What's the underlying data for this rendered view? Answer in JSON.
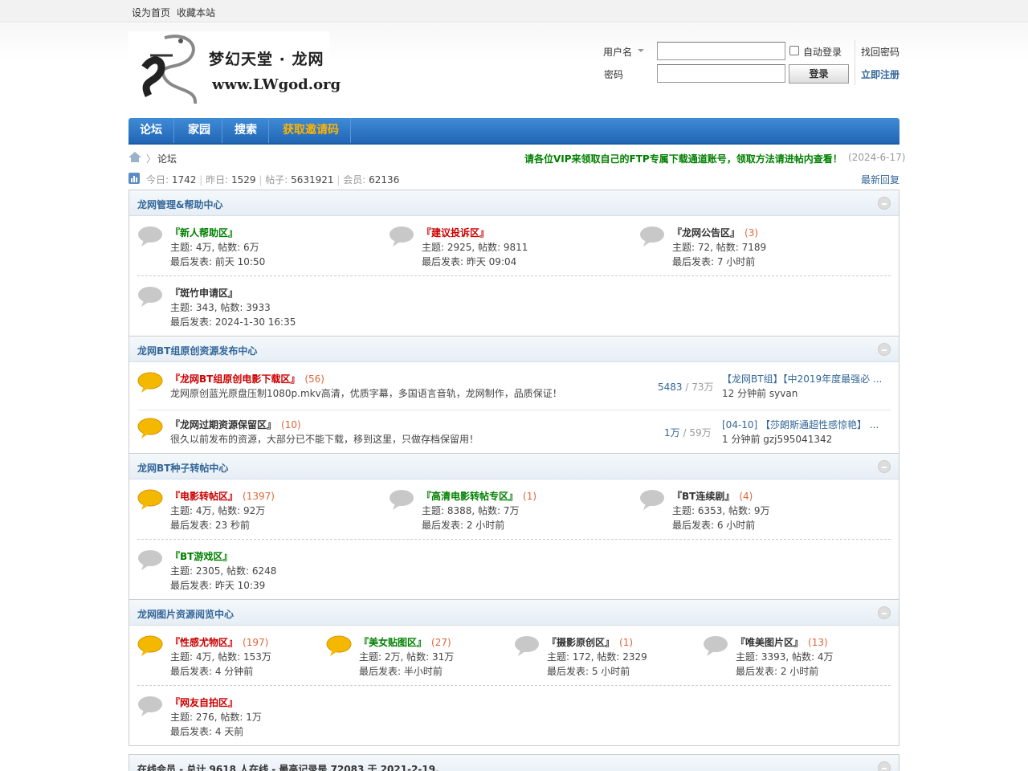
{
  "topbar": {
    "set_home": "设为首页",
    "bookmark": "收藏本站"
  },
  "logo": {
    "line1": "梦幻天堂 · 龙网",
    "line2": "www.LWgod.org"
  },
  "login": {
    "username_label": "用户名",
    "password_label": "密码",
    "auto_login": "自动登录",
    "login_btn": "登录",
    "find_password": "找回密码",
    "register": "立即注册"
  },
  "nav": {
    "items": [
      "论坛",
      "家园",
      "搜索",
      "获取邀请码"
    ]
  },
  "breadcrumb": {
    "current": "论坛",
    "notice": "请各位VIP来领取自己的FTP专属下载通道账号，领取方法请进帖内查看！",
    "notice_date": "(2024-6-17)"
  },
  "stats": {
    "today_label": "今日:",
    "today": "1742",
    "yesterday_label": "昨日:",
    "yesterday": "1529",
    "posts_label": "帖子:",
    "posts": "5631921",
    "members_label": "会员:",
    "members": "62136",
    "latest": "最新回复"
  },
  "categories": [
    {
      "title": "龙网管理&帮助中心",
      "forums": [
        {
          "name": "『新人帮助区』",
          "count": "",
          "stats": "主题: 4万, 帖数: 6万",
          "last": "最后发表: 前天 10:50"
        },
        {
          "name": "『建议投诉区』",
          "count": "",
          "stats": "主题: 2925, 帖数: 9811",
          "last": "最后发表: 昨天 09:04"
        },
        {
          "name": "『龙网公告区』",
          "count": "(3)",
          "stats": "主题: 72, 帖数: 7189",
          "last": "最后发表: 7 小时前"
        },
        {
          "name": "『斑竹申请区』",
          "count": "",
          "stats": "主题: 343, 帖数: 3933",
          "last": "最后发表: 2024-1-30 16:35"
        }
      ]
    },
    {
      "title": "龙网BT组原创资源发布中心",
      "forums": [
        {
          "name": "『龙网BT组原创电影下载区』",
          "count": "(56)",
          "desc": "龙网原创蓝光原盘压制1080p.mkv高清，优质字幕，多国语言音轨，龙网制作，品质保证！",
          "topics": "5483",
          "posts": "/ 73万",
          "last_title": "【龙网BT组】【中2019年度最强必 ...",
          "last_by": "12 分钟前 syvan"
        },
        {
          "name": "『龙网过期资源保留区』",
          "count": "(10)",
          "desc": "很久以前发布的资源，大部分已不能下载，移到这里，只做存档保留用！",
          "topics": "1万",
          "posts": "/ 59万",
          "last_title": "[04-10] 【莎朗斯通超性感惊艳】 ...",
          "last_by": "1 分钟前 gzj595041342"
        }
      ]
    },
    {
      "title": "龙网BT种子转帖中心",
      "forums": [
        {
          "name": "『电影转帖区』",
          "count": "(1397)",
          "stats": "主题: 4万, 帖数: 92万",
          "last": "最后发表: 23 秒前"
        },
        {
          "name": "『高清电影转帖专区』",
          "count": "(1)",
          "stats": "主题: 8388, 帖数: 7万",
          "last": "最后发表: 2 小时前"
        },
        {
          "name": "『BT连续剧』",
          "count": "(4)",
          "stats": "主题: 6353, 帖数: 9万",
          "last": "最后发表: 6 小时前"
        },
        {
          "name": "『BT游戏区』",
          "count": "",
          "stats": "主题: 2305, 帖数: 6248",
          "last": "最后发表: 昨天 10:39"
        }
      ]
    },
    {
      "title": "龙网图片资源阅览中心",
      "forums": [
        {
          "name": "『性感尤物区』",
          "count": "(197)",
          "stats": "主题: 4万, 帖数: 153万",
          "last": "最后发表: 4 分钟前"
        },
        {
          "name": "『美女贴图区』",
          "count": "(27)",
          "stats": "主题: 2万, 帖数: 31万",
          "last": "最后发表: 半小时前"
        },
        {
          "name": "『摄影原创区』",
          "count": "(1)",
          "stats": "主题: 172, 帖数: 2329",
          "last": "最后发表: 5 小时前"
        },
        {
          "name": "『唯美图片区』",
          "count": "(13)",
          "stats": "主题: 3393, 帖数: 4万",
          "last": "最后发表: 2 小时前"
        },
        {
          "name": "『网友自拍区』",
          "count": "",
          "stats": "主题: 276, 帖数: 1万",
          "last": "最后发表: 4 天前"
        }
      ]
    }
  ],
  "online": {
    "text": "在线会员 - 总计 9618 人在线 - 最高记录是 72083 于 2021-2-19."
  },
  "colors": {
    "nav_blue": "#2a74c7",
    "invite": "#ffb400",
    "notice_green": "#008000",
    "count_orange": "#e0663a",
    "cat_title": "#336699"
  },
  "icons": {
    "forum_new": "speech-bubble-yellow-icon",
    "forum_old": "speech-bubble-gray-icon"
  }
}
